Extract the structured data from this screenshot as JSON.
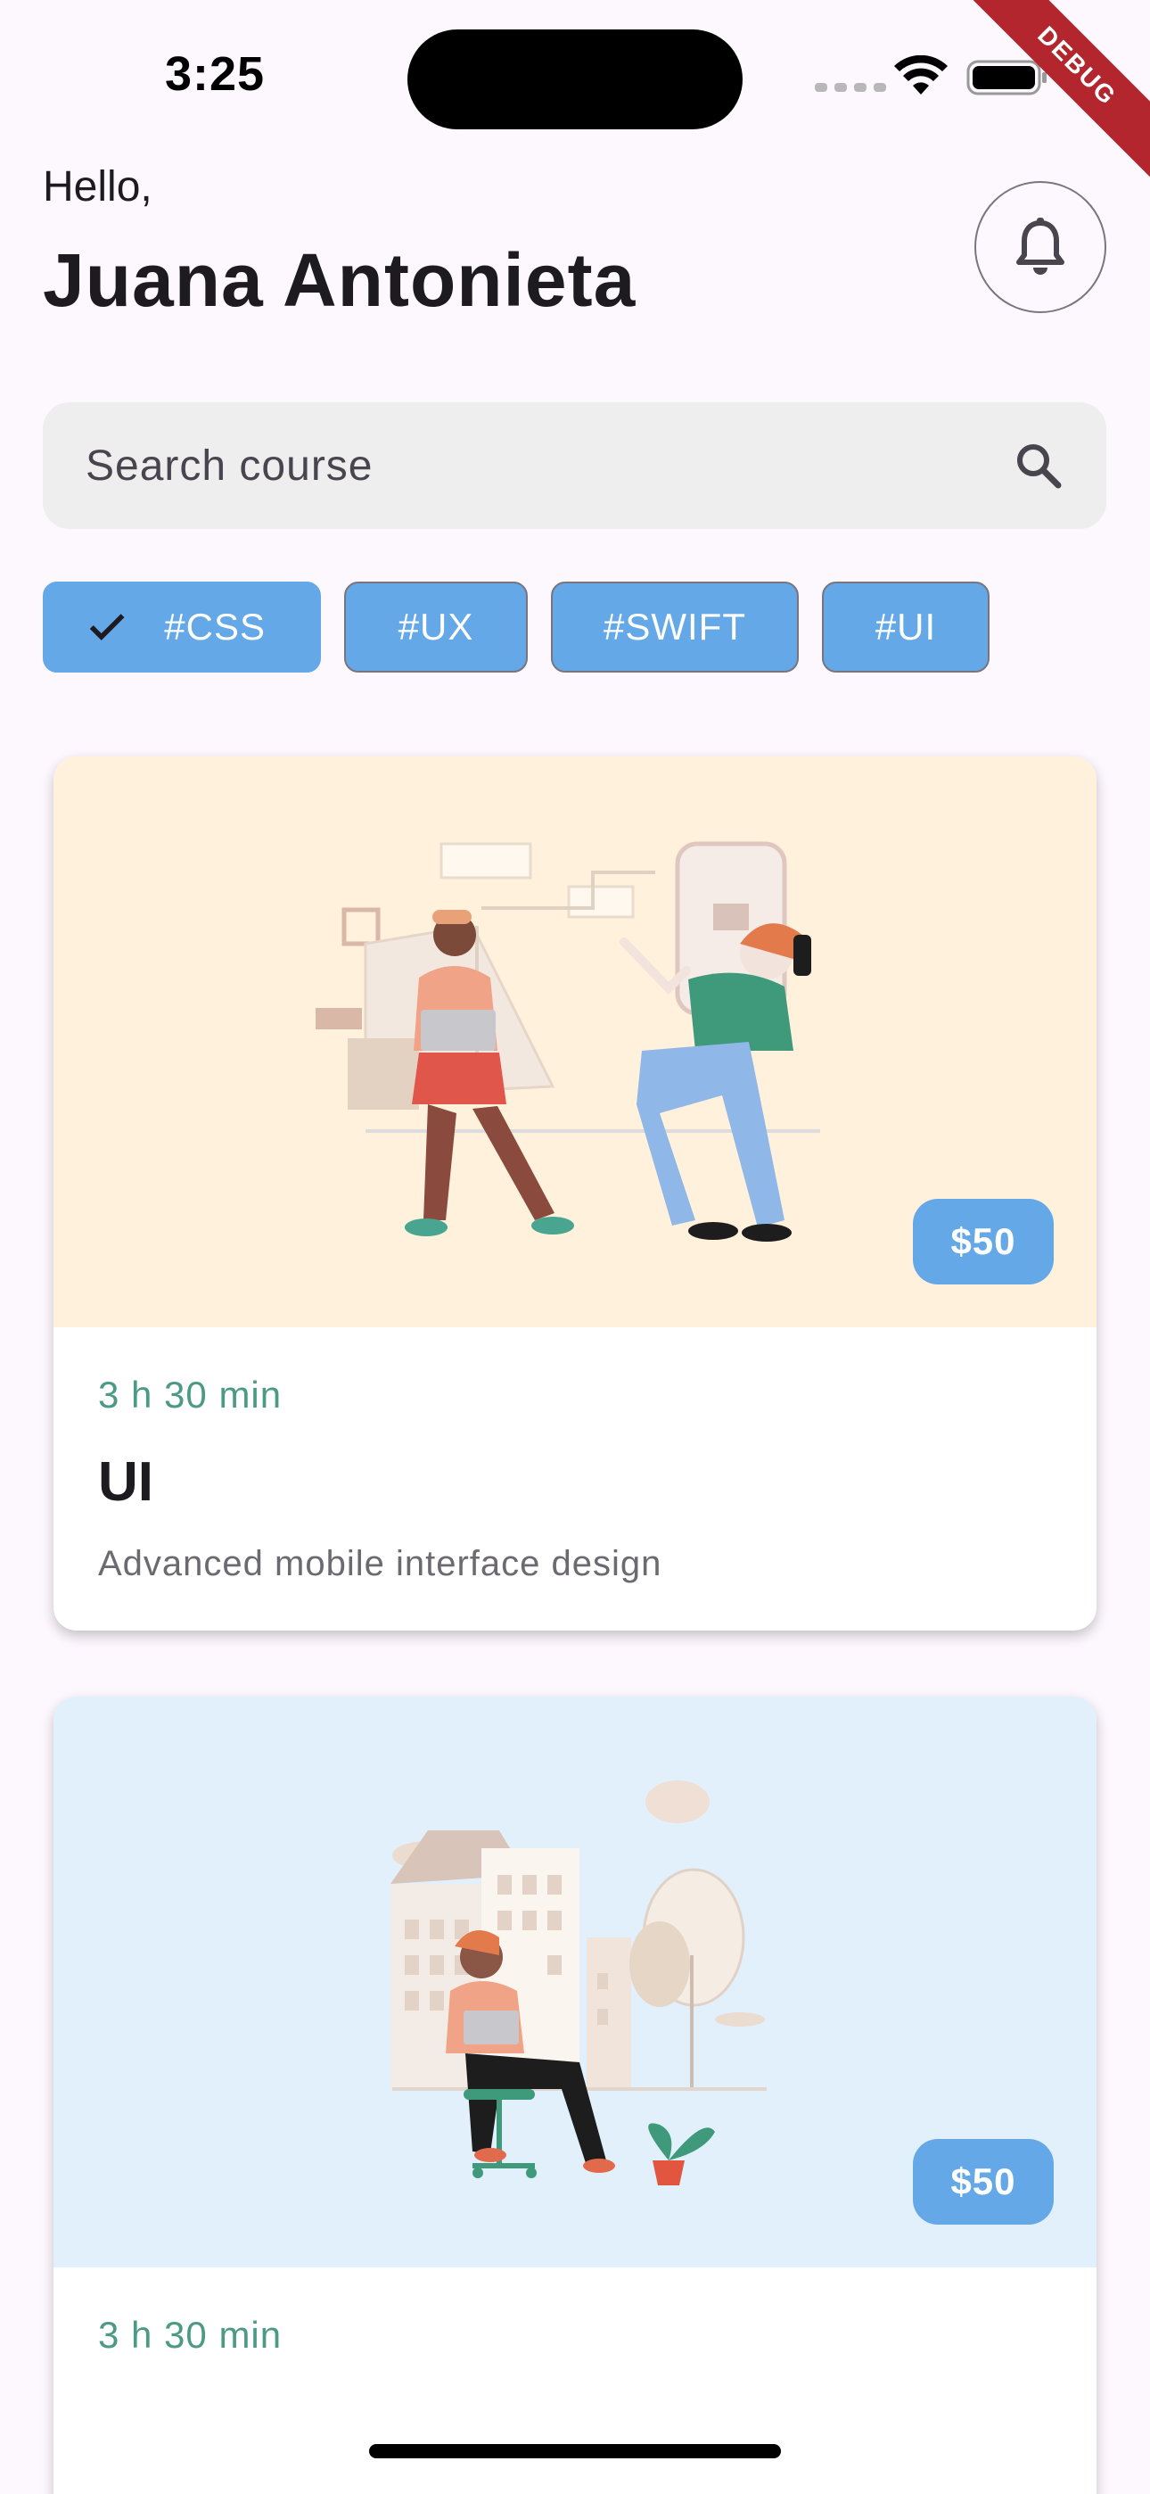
{
  "status_bar": {
    "time": "3:25",
    "debug_label": "DEBUG"
  },
  "header": {
    "greeting": "Hello,",
    "user_name": "Juana Antonieta",
    "notification_icon": "bell-icon"
  },
  "search": {
    "placeholder": "Search course",
    "icon": "search-icon"
  },
  "filters": {
    "chips": [
      {
        "label": "#CSS",
        "selected": true
      },
      {
        "label": "#UX",
        "selected": false
      },
      {
        "label": "#SWIFT",
        "selected": false
      },
      {
        "label": "#UI",
        "selected": false
      }
    ],
    "chip_color": "#64a8e8"
  },
  "courses": [
    {
      "price": "$50",
      "duration": "3 h 30 min",
      "title": "UI",
      "description": "Advanced mobile interface design",
      "image_background": "#fff1dc"
    },
    {
      "price": "$50",
      "duration": "3 h 30 min",
      "title": "",
      "description": "",
      "image_background": "#e2f0fc"
    }
  ],
  "colors": {
    "accent": "#64a8e8",
    "duration_text": "#4c9a85",
    "background": "#fdf7fe"
  }
}
